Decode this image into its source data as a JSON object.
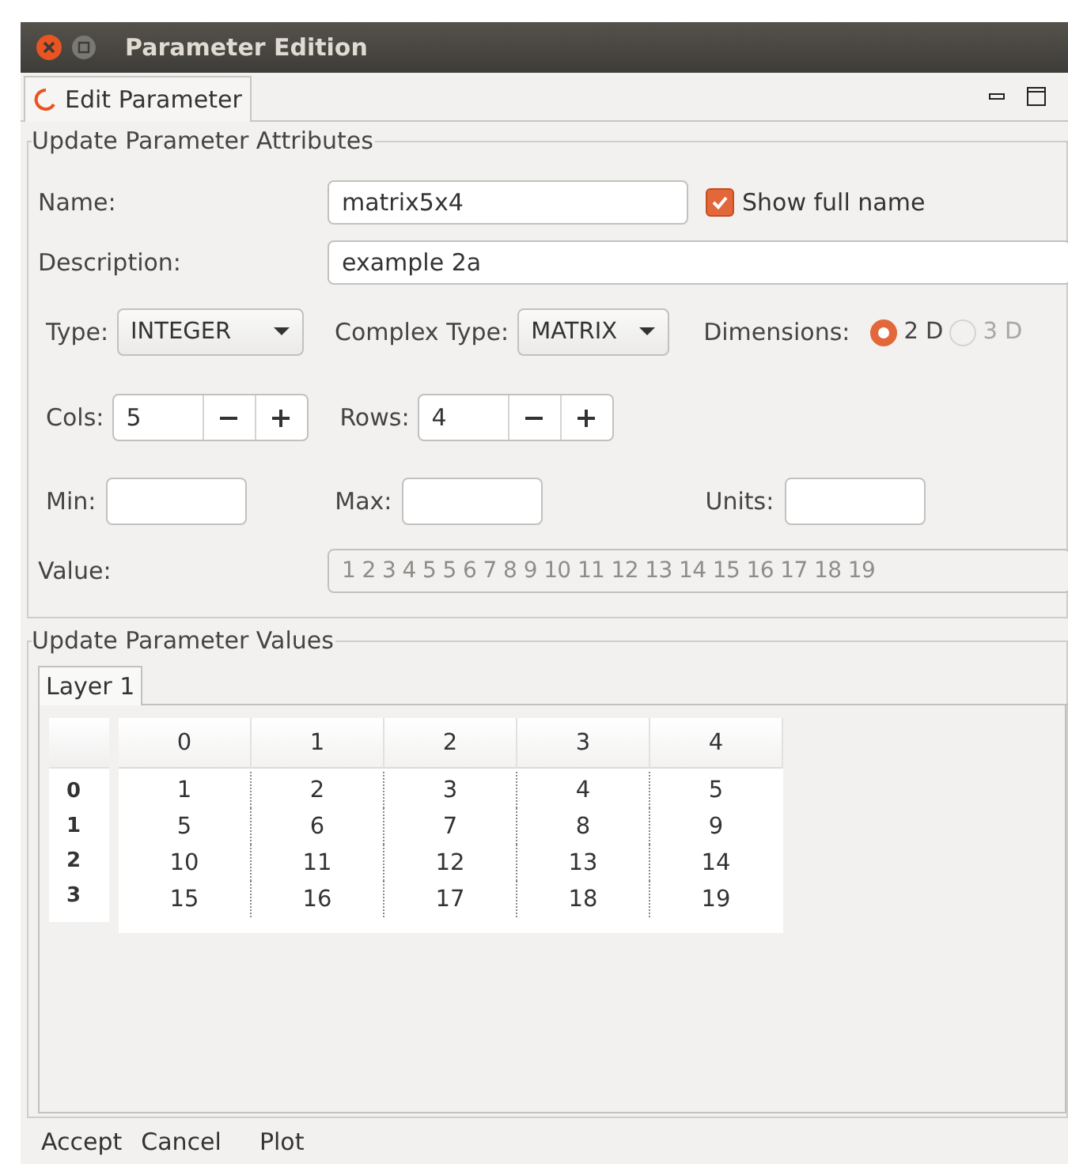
{
  "window": {
    "title": "Parameter Edition"
  },
  "tabs": [
    {
      "label": "Edit Parameter",
      "selected": true
    }
  ],
  "attributes": {
    "title": "Update Parameter Attributes",
    "name": {
      "label": "Name:",
      "value": "matrix5x4"
    },
    "show_full_name": {
      "label": "Show full name",
      "checked": true
    },
    "description": {
      "label": "Description:",
      "value": "example 2a"
    },
    "type": {
      "label": "Type:",
      "value": "INTEGER"
    },
    "complex_type": {
      "label": "Complex Type:",
      "value": "MATRIX"
    },
    "dimensions": {
      "label": "Dimensions:",
      "options": [
        {
          "label": "2 D",
          "selected": true,
          "disabled": false
        },
        {
          "label": "3 D",
          "selected": false,
          "disabled": true
        }
      ]
    },
    "cols": {
      "label": "Cols:",
      "value": "5"
    },
    "rows": {
      "label": "Rows:",
      "value": "4"
    },
    "min": {
      "label": "Min:"
    },
    "max": {
      "label": "Max:"
    },
    "units": {
      "label": "Units:"
    },
    "value": {
      "label": "Value:",
      "value": "1 2 3 4 5 5 6 7 8 9 10 11 12 13 14 15 16 17 18 19",
      "disabled": true
    }
  },
  "values": {
    "title": "Update Parameter Values",
    "layers": [
      {
        "label": "Layer 1",
        "selected": true
      }
    ],
    "table": {
      "columns": [
        "0",
        "1",
        "2",
        "3",
        "4"
      ],
      "row_headers": [
        "0",
        "1",
        "2",
        "3"
      ],
      "rows": [
        [
          "1",
          "2",
          "3",
          "4",
          "5"
        ],
        [
          "5",
          "6",
          "7",
          "8",
          "9"
        ],
        [
          "10",
          "11",
          "12",
          "13",
          "14"
        ],
        [
          "15",
          "16",
          "17",
          "18",
          "19"
        ]
      ]
    }
  },
  "buttons": [
    "Accept",
    "Cancel",
    "Plot"
  ]
}
